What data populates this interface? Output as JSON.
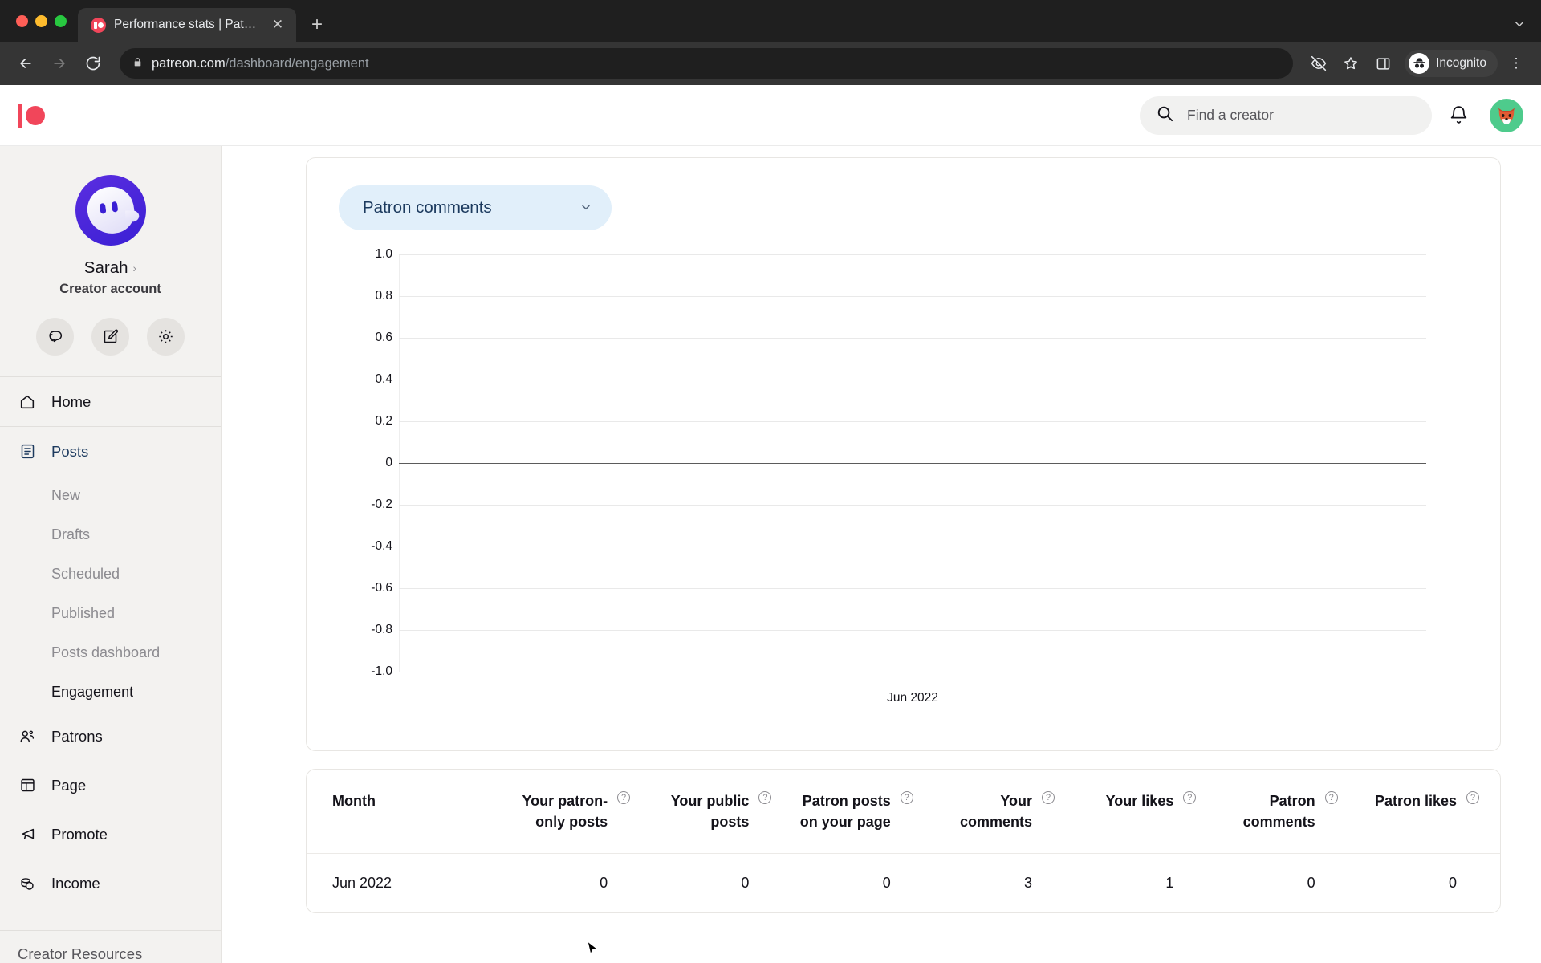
{
  "browser": {
    "tab": {
      "title": "Performance stats | Patreon",
      "favicon": "patreon-favicon",
      "close": "✕"
    },
    "newtab_label": "+",
    "tabstrip_chevron": "⌄",
    "nav": {
      "back": "←",
      "forward": "→",
      "reload": "⟳"
    },
    "omnibox": {
      "lock": "🔒",
      "url_domain": "patreon.com",
      "url_path": "/dashboard/engagement"
    },
    "toolbar": {
      "tracking_protection": "eye-off-icon",
      "bookmark": "☆",
      "side_panel": "side-panel-icon",
      "incognito_label": "Incognito",
      "menu": "⋮"
    }
  },
  "topbar": {
    "logo": "patreon-logo",
    "search": {
      "placeholder": "Find a creator",
      "icon": "search-icon"
    },
    "notifications_icon": "bell-icon",
    "avatar": "fox-avatar"
  },
  "sidebar": {
    "profile": {
      "avatar": "ghost-avatar",
      "name": "Sarah",
      "chevron": "›",
      "role": "Creator account"
    },
    "quick_actions": [
      {
        "name": "messages",
        "icon": "chat-bubbles-icon"
      },
      {
        "name": "compose",
        "icon": "edit-square-icon"
      },
      {
        "name": "settings",
        "icon": "gear-icon"
      }
    ],
    "items": [
      {
        "label": "Home",
        "icon": "home-icon",
        "active": false
      },
      {
        "label": "Posts",
        "icon": "posts-icon",
        "active": true
      },
      {
        "label": "Patrons",
        "icon": "patrons-icon",
        "active": false
      },
      {
        "label": "Page",
        "icon": "page-icon",
        "active": false
      },
      {
        "label": "Promote",
        "icon": "megaphone-icon",
        "active": false
      },
      {
        "label": "Income",
        "icon": "coins-icon",
        "active": false
      }
    ],
    "posts_subitems": [
      {
        "label": "New",
        "active": false
      },
      {
        "label": "Drafts",
        "active": false
      },
      {
        "label": "Scheduled",
        "active": false
      },
      {
        "label": "Published",
        "active": false
      },
      {
        "label": "Posts dashboard",
        "active": false
      },
      {
        "label": "Engagement",
        "active": true
      }
    ],
    "footer": {
      "label": "Creator Resources"
    }
  },
  "main": {
    "metric_dropdown": {
      "label": "Patron comments",
      "chevron": "⌄"
    }
  },
  "chart_data": {
    "type": "line",
    "title": "",
    "xlabel": "",
    "ylabel": "",
    "x": [
      "Jun 2022"
    ],
    "series": [
      {
        "name": "Patron comments",
        "values": [
          0
        ]
      }
    ],
    "yticks": [
      "1.0",
      "0.8",
      "0.6",
      "0.4",
      "0.2",
      "0",
      "-0.2",
      "-0.4",
      "-0.6",
      "-0.8",
      "-1.0"
    ],
    "ylim": [
      -1.0,
      1.0
    ],
    "grid": true,
    "legend": "none",
    "zero_line": true
  },
  "table": {
    "columns": [
      {
        "label": "Month",
        "help": false
      },
      {
        "label": "Your patron-only posts",
        "help": true
      },
      {
        "label": "Your public posts",
        "help": true
      },
      {
        "label": "Patron posts on your page",
        "help": true
      },
      {
        "label": "Your comments",
        "help": true
      },
      {
        "label": "Your likes",
        "help": true
      },
      {
        "label": "Patron comments",
        "help": true
      },
      {
        "label": "Patron likes",
        "help": true
      }
    ],
    "help_glyph": "?",
    "rows": [
      {
        "month": "Jun 2022",
        "values": [
          "0",
          "0",
          "0",
          "3",
          "1",
          "0",
          "0"
        ]
      }
    ]
  },
  "colors": {
    "brand_red": "#f1465a",
    "accent_blue": "#1c3a5e",
    "pill_bg": "#e1effa",
    "sidebar_bg": "#f3f2f0",
    "avatar_green": "#4ecb8c",
    "ghost_purple": "#3a1fd4"
  }
}
